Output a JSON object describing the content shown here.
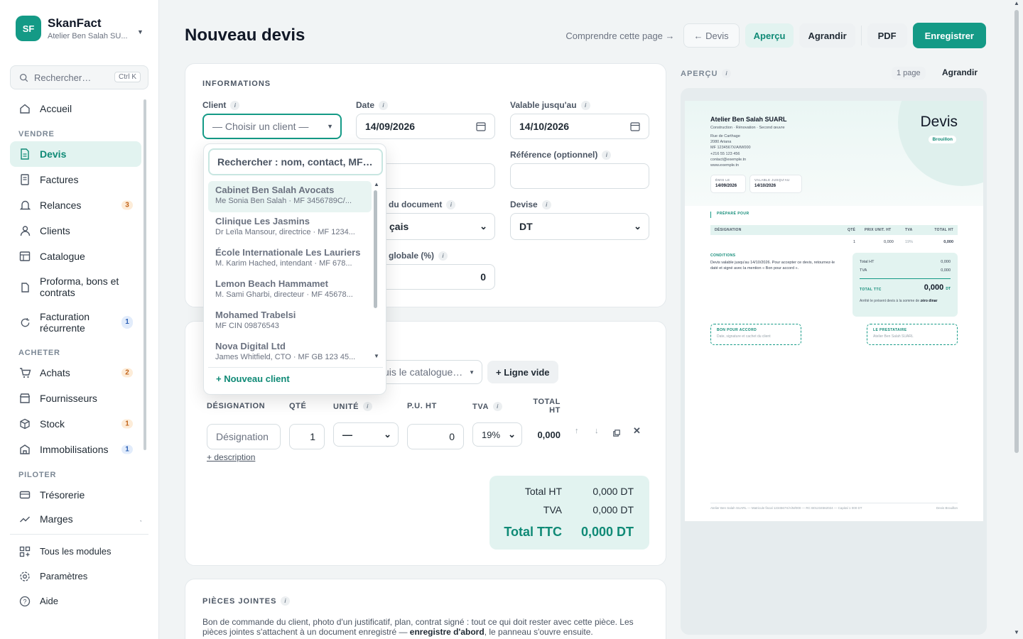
{
  "brand": {
    "initials": "SF",
    "name": "SkanFact",
    "company": "Atelier Ben Salah SU..."
  },
  "search": {
    "placeholder": "Rechercher…",
    "shortcut": "Ctrl K"
  },
  "nav": {
    "home": "Accueil",
    "sect_sell": "VENDRE",
    "quotes": "Devis",
    "invoices": "Factures",
    "reminders": "Relances",
    "reminders_count": "3",
    "clients": "Clients",
    "catalog": "Catalogue",
    "proforma_l1": "Proforma, bons et",
    "proforma_l2": "contrats",
    "recurring_l1": "Facturation",
    "recurring_l2": "récurrente",
    "recurring_count": "1",
    "sect_buy": "ACHETER",
    "purchases": "Achats",
    "purchases_count": "2",
    "suppliers": "Fournisseurs",
    "stock": "Stock",
    "stock_count": "1",
    "assets": "Immobilisations",
    "assets_count": "1",
    "sect_steer": "PILOTER",
    "treasury": "Trésorerie",
    "margins": "Marges"
  },
  "footer_nav": {
    "modules": "Tous les modules",
    "settings": "Paramètres",
    "help": "Aide"
  },
  "header": {
    "title": "Nouveau devis",
    "understand": "Comprendre cette page →",
    "back": "← Devis",
    "preview": "Aperçu",
    "enlarge": "Agrandir",
    "pdf": "PDF",
    "save": "Enregistrer"
  },
  "info": {
    "section": "INFORMATIONS",
    "client_label": "Client",
    "client_value": "— Choisir un client —",
    "date_label": "Date",
    "date_value": "14/09/2026",
    "valid_label": "Valable jusqu'au",
    "valid_value": "14/10/2026",
    "ref_label": "Référence (optionnel)",
    "lang_label": "du document",
    "lang_value": "çais",
    "currency_label": "Devise",
    "currency_value": "DT",
    "discount_label": "globale (%)",
    "discount_value": "0"
  },
  "dropdown": {
    "search": "Rechercher : nom, contact, MF…",
    "options": [
      {
        "name": "Cabinet Ben Salah Avocats",
        "sub": "Me Sonia Ben Salah · MF 3456789C/..."
      },
      {
        "name": "Clinique Les Jasmins",
        "sub": "Dr Leïla Mansour, directrice · MF 1234..."
      },
      {
        "name": "École Internationale Les Lauriers",
        "sub": "M. Karim Hached, intendant · MF 678..."
      },
      {
        "name": "Lemon Beach Hammamet",
        "sub": "M. Sami Gharbi, directeur · MF 45678..."
      },
      {
        "name": "Mohamed Trabelsi",
        "sub": "MF CIN 09876543"
      },
      {
        "name": "Nova Digital Ltd",
        "sub": "James Whitfield, CTO · MF GB 123 45..."
      }
    ],
    "new_client": "+ Nouveau client"
  },
  "lines": {
    "catalog_placeholder": "uis le catalogue…",
    "empty_line": "+ Ligne vide",
    "h_designation": "DÉSIGNATION",
    "h_qty": "QTÉ",
    "h_unit": "UNITÉ",
    "h_pu": "P.U. HT",
    "h_tva": "TVA",
    "h_total_l1": "TOTAL",
    "h_total_l2": "HT",
    "designation_placeholder": "Désignation",
    "qty": "1",
    "unit": "—",
    "pu": "0",
    "tva": "19%",
    "total": "0,000",
    "add_description": "+ description",
    "tot_ht_label": "Total HT",
    "tot_ht": "0,000 DT",
    "tva_label": "TVA",
    "tva_value": "0,000 DT",
    "ttc_label": "Total TTC",
    "ttc": "0,000 DT"
  },
  "attachments": {
    "section": "PIÈCES JOINTES",
    "text_1": "Bon de commande du client, photo d'un justificatif, plan, contrat signé : tout ce qui doit rester avec cette pièce. Les",
    "text_2a": "pièces jointes s'attachent à un document enregistré — ",
    "text_2b": "enregistre d'abord",
    "text_2c": ", le panneau s'ouvre ensuite."
  },
  "preview": {
    "section": "APERÇU",
    "pages": "1 page",
    "enlarge": "Agrandir",
    "company": "Atelier Ben Salah SUARL",
    "tagline": "Construction · Rénovation · Second œuvre",
    "addr": [
      "Rue de Carthage",
      "2080 Ariana",
      "MF 1234567X/A/M/000",
      "+216 55 123 456",
      "contact@exemple.tn",
      "www.exemple.tn"
    ],
    "doc_title": "Devis",
    "status": "Brouillon",
    "issued_label": "ÉMIS LE",
    "issued": "14/09/2026",
    "valid_label": "VALABLE JUSQU'AU",
    "valid": "14/10/2026",
    "prepared_for": "PRÉPARÉ POUR",
    "cols": [
      "DÉSIGNATION",
      "QTÉ",
      "PRIX UNIT. HT",
      "TVA",
      "TOTAL HT"
    ],
    "row": [
      "1",
      "0,000",
      "19%",
      "0,000"
    ],
    "conditions": "CONDITIONS",
    "conditions_text": "Devis valable jusqu'au 14/10/2026. Pour accepter ce devis, retournez-le daté et signé avec la mention « Bon pour accord ».",
    "sum_ht_label": "Total HT",
    "sum_ht": "0,000",
    "sum_tva_label": "TVA",
    "sum_tva": "0,000",
    "sum_ttc_label": "TOTAL TTC",
    "sum_ttc": "0,000",
    "currency": "DT",
    "words_a": "Arrêté le présent devis à la somme de ",
    "words_b": "zéro dinar",
    "accord": "BON POUR ACCORD",
    "accord_sub": "Date, signature et cachet du client",
    "provider": "LE PRESTATAIRE",
    "provider_sub": "Atelier Ben Salah SUARL",
    "footer": "Atelier Ben Salah SUARL — Matricule fiscal 1234567X/A/M/000 — RC B01234562024 — Capital 1 000 DT",
    "footer_right": "Devis Brouillon"
  }
}
